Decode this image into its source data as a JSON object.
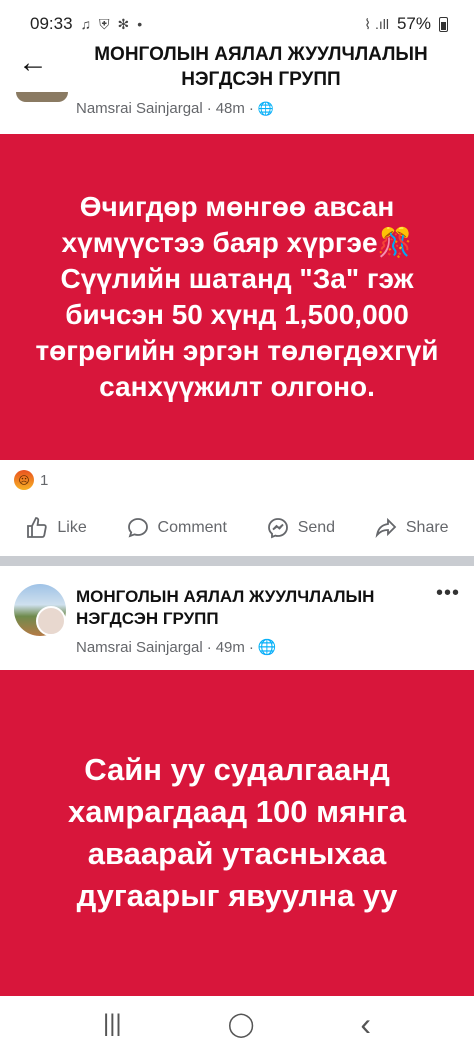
{
  "status_bar": {
    "time": "09:33",
    "left_icons": [
      "♫",
      "⛨",
      "✻",
      "•"
    ],
    "signal_icons": "⌇ .ıll",
    "battery_pct": "57%"
  },
  "header": {
    "title": "МОНГОЛЫН АЯЛАЛ ЖУУЛЧЛАЛЫН НЭГДСЭН ГРУПП"
  },
  "post1": {
    "author": "Namsrai Sainjargal",
    "time": "48m",
    "text": "Өчигдөр мөнгөө авсан хүмүүстээ баяр хүргэе🎊 Сүүлийн шатанд \"За\" гэж бичсэн 50 хүнд 1,500,000 төгрөгийн эргэн төлөгдөхгүй санхүүжилт олгоно.",
    "reaction_count": "1",
    "actions": {
      "like": "Like",
      "comment": "Comment",
      "send": "Send",
      "share": "Share"
    }
  },
  "post2": {
    "group": "МОНГОЛЫН АЯЛАЛ ЖУУЛЧЛАЛЫН НЭГДСЭН ГРУПП",
    "author": "Namsrai Sainjargal",
    "time": "49m",
    "more": "•••",
    "text": "Сайн уу судалгаанд хамрагдаад 100 мянга аваарай утасныхаа дугаарыг явуулна уу"
  },
  "navbar": {
    "recent": "|||",
    "home": "◯",
    "back": "‹"
  },
  "colors": {
    "card_red": "#d8163b",
    "meta_gray": "#65676b"
  }
}
